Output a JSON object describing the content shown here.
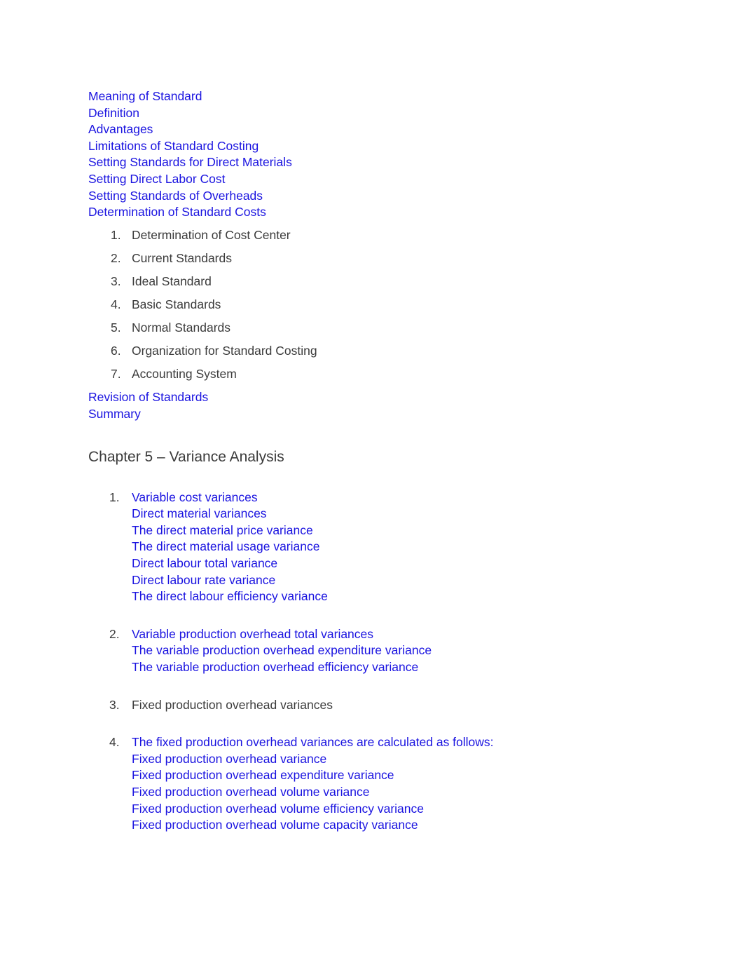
{
  "document": {
    "colors": {
      "link_blue": "#1a13e0",
      "body_dark": "#3b3b3b",
      "page_background": "#ffffff"
    },
    "toc_top": {
      "lines": [
        {
          "text": "Meaning of Standard",
          "color": "blue"
        },
        {
          "text": "Definition",
          "color": "blue"
        },
        {
          "text": "Advantages",
          "color": "blue"
        },
        {
          "text": "Limitations of Standard Costing",
          "color": "blue"
        },
        {
          "text": "Setting Standards for Direct Materials",
          "color": "blue"
        },
        {
          "text": "Setting Direct Labor Cost",
          "color": "blue"
        },
        {
          "text": "Setting Standards of Overheads",
          "color": "blue"
        },
        {
          "text": "Determination of Standard Costs",
          "color": "blue"
        }
      ]
    },
    "outline_list": {
      "items": [
        {
          "number": "1.",
          "text": "Determination of Cost Center"
        },
        {
          "number": "2.",
          "text": "Current Standards"
        },
        {
          "number": "3.",
          "text": "Ideal Standard"
        },
        {
          "number": "4.",
          "text": "Basic Standards"
        },
        {
          "number": "5.",
          "text": "Normal Standards"
        },
        {
          "number": "6.",
          "text": "Organization for Standard Costing"
        },
        {
          "number": "7.",
          "text": "Accounting System"
        }
      ]
    },
    "toc_bottom": {
      "lines": [
        {
          "text": "Revision of Standards",
          "color": "blue"
        },
        {
          "text": "Summary",
          "color": "blue"
        }
      ]
    },
    "chapter_heading": "Chapter 5 – Variance Analysis",
    "variance_list": {
      "items": [
        {
          "number": "1.",
          "lines": [
            {
              "text": "Variable cost variances",
              "color": "blue"
            },
            {
              "text": "Direct material variances",
              "color": "blue"
            },
            {
              "text": "The direct material price variance",
              "color": "blue"
            },
            {
              "text": "The direct material usage variance",
              "color": "blue"
            },
            {
              "text": "Direct labour total variance",
              "color": "blue"
            },
            {
              "text": "Direct labour rate variance",
              "color": "blue"
            },
            {
              "text": "The direct labour efficiency variance",
              "color": "blue"
            }
          ]
        },
        {
          "number": "2.",
          "lines": [
            {
              "text": "Variable production overhead total variances",
              "color": "blue"
            },
            {
              "text": "The variable production overhead expenditure variance",
              "color": "blue"
            },
            {
              "text": "The variable production overhead efficiency variance",
              "color": "blue"
            }
          ]
        },
        {
          "number": "3.",
          "lines": [
            {
              "text": "Fixed production overhead variances",
              "color": "dark"
            }
          ]
        },
        {
          "number": "4.",
          "lines": [
            {
              "text": "The fixed production overhead variances are calculated as follows:",
              "color": "blue"
            },
            {
              "text": "Fixed production overhead variance",
              "color": "blue"
            },
            {
              "text": "Fixed production overhead expenditure variance",
              "color": "blue"
            },
            {
              "text": "Fixed production overhead volume variance",
              "color": "blue"
            },
            {
              "text": "Fixed production overhead volume efficiency variance",
              "color": "blue"
            },
            {
              "text": "Fixed production overhead volume capacity variance",
              "color": "blue"
            }
          ]
        }
      ]
    }
  }
}
